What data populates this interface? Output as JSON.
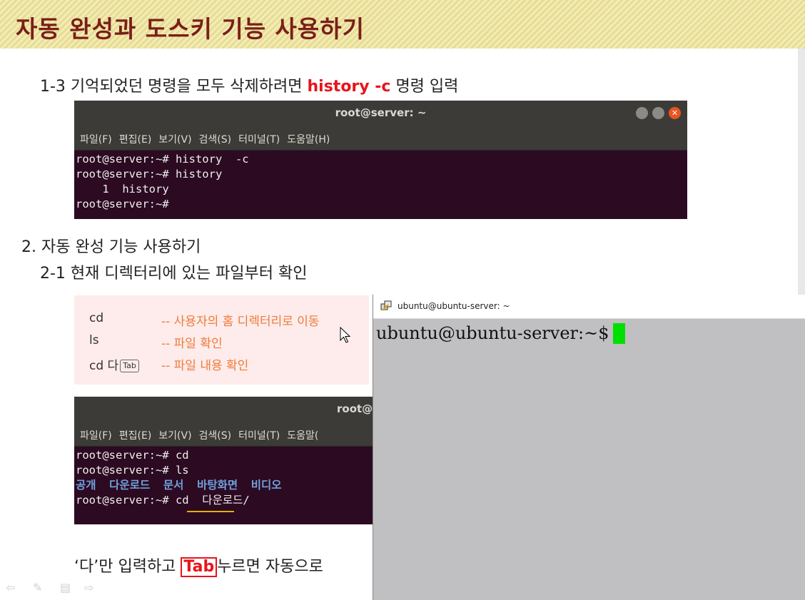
{
  "slide": {
    "title": "자동 완성과 도스키 기능 사용하기",
    "line1_text": "1-3 기억되었던 명령을 모두 삭제하려면 ",
    "line1_highlight": "history -c",
    "line1_tail": " 명령 입력",
    "section2": "2. 자동 완성 기능 사용하기",
    "section2_1": "2-1 현재 디렉터리에 있는 파일부터 확인",
    "bottom_text_a": "‘다’만 입력하고 ",
    "bottom_tab": "Tab",
    "bottom_text_b": "누르면 자동으로"
  },
  "terminal1": {
    "title": "root@server: ~",
    "close_glyph": "✕",
    "menu": [
      "파일(F)",
      "편집(E)",
      "보기(V)",
      "검색(S)",
      "터미널(T)",
      "도움말(H)"
    ],
    "lines": [
      "root@server:~# history  -c",
      "root@server:~# history",
      "    1  history",
      "root@server:~#"
    ]
  },
  "callout": {
    "rows": [
      {
        "cmd": "cd",
        "comment": "-- 사용자의 홈 디렉터리로 이동"
      },
      {
        "cmd": "ls",
        "comment": "-- 파일 확인"
      },
      {
        "cmd": "cd 다",
        "tab": "Tab",
        "comment": "-- 파일 내용 확인"
      }
    ]
  },
  "terminal2": {
    "title": "root@",
    "menu": [
      "파일(F)",
      "편집(E)",
      "보기(V)",
      "검색(S)",
      "터미널(T)",
      "도움말("
    ],
    "line1": "root@server:~# cd",
    "line2": "root@server:~# ls",
    "ls_output": "공개  다운로드  문서  바탕화면  비디오",
    "line4": "root@server:~# cd  다운로드/"
  },
  "putty": {
    "title": "ubuntu@ubuntu-server: ~",
    "prompt": "ubuntu@ubuntu-server:~$",
    "cursor_color": "#00e000"
  },
  "colors": {
    "title_text": "#7a1e1a",
    "highlight_red": "#e8141b",
    "terminal_bg": "#2c0a22",
    "terminal_bar": "#3c3b37",
    "comment_orange": "#f07a3a",
    "ls_blue": "#6fa1dc"
  },
  "icons": [
    "back-arrow-icon",
    "pen-icon",
    "menu-icon",
    "forward-arrow-icon",
    "putty-terminal-icon",
    "mouse-pointer-icon"
  ]
}
